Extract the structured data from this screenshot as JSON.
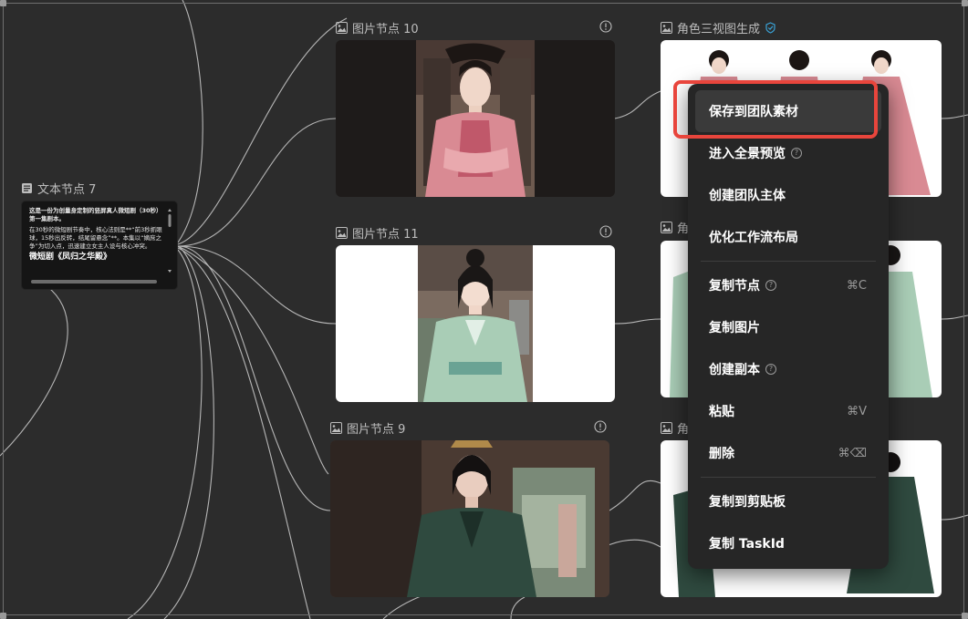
{
  "text_node": {
    "title": "文本节点 7",
    "para1": "这是一份为创量身定制的竖屏真人微短剧（30秒）第一集剧本。",
    "para2": "在30秒的微短剧节奏中，核心法则是**“前3秒抓眼球，15秒出反转，结尾留悬念”**。本集以“嫡庶之争”为切入点，迅速建立女主人设与核心冲突。",
    "para3": "微短剧《凤归之华殿》"
  },
  "nodes": [
    {
      "title": "图片节点 10"
    },
    {
      "title": "图片节点 11"
    },
    {
      "title": "图片节点 9"
    },
    {
      "title": "角色三视图生成"
    },
    {
      "title": "角"
    },
    {
      "title": "角"
    }
  ],
  "context_menu": {
    "items": [
      {
        "label": "保存到团队素材"
      },
      {
        "label": "进入全景预览",
        "help": "?"
      },
      {
        "label": "创建团队主体"
      },
      {
        "label": "优化工作流布局"
      },
      {
        "label": "复制节点",
        "help": "?",
        "shortcut": "⌘C"
      },
      {
        "label": "复制图片"
      },
      {
        "label": "创建副本",
        "help": "?"
      },
      {
        "label": "粘贴",
        "shortcut": "⌘V"
      },
      {
        "label": "删除",
        "shortcut": "⌘⌫"
      },
      {
        "label": "复制到剪贴板"
      },
      {
        "label": "复制 TaskId"
      }
    ]
  },
  "colors": {
    "canvas": "#2c2c2c",
    "highlight": "#e8453c",
    "verified": "#3aa3d8",
    "pink_dress": "#d98a93",
    "mint_dress": "#a9cdb6",
    "dark_green_dress": "#2f4a3f"
  },
  "icons": [
    "image-icon",
    "document-icon",
    "info-icon",
    "verified-badge-icon",
    "help-icon"
  ]
}
